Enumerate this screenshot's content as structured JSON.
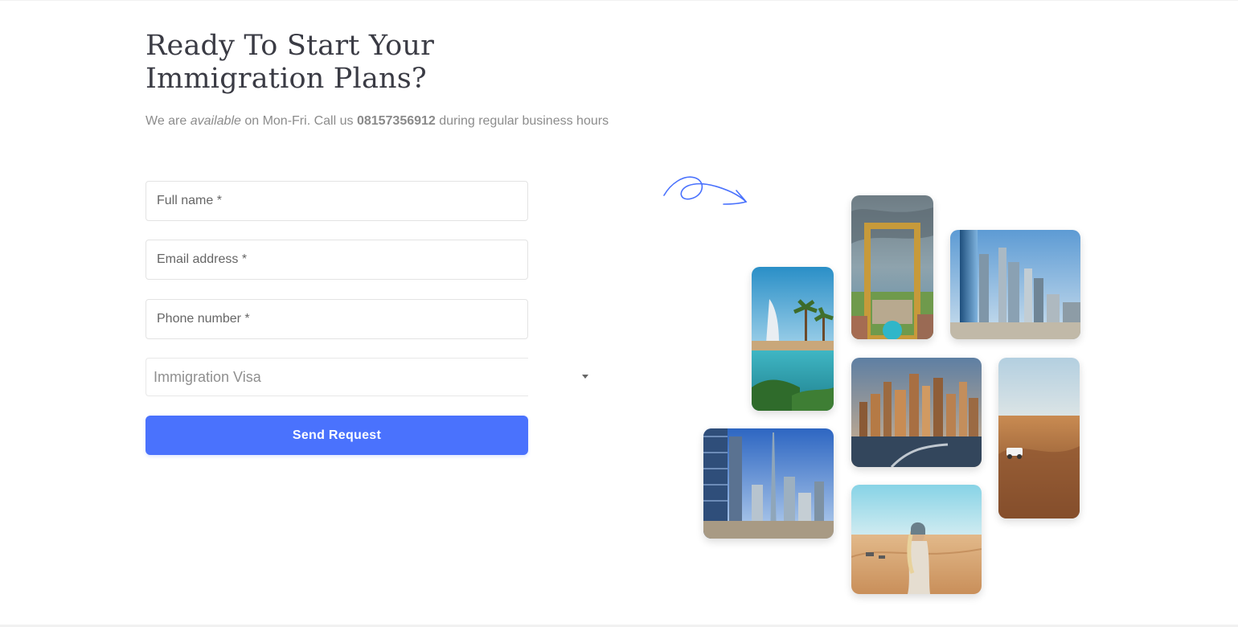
{
  "header": {
    "title": "Ready To Start Your Immigration Plans?",
    "subtitle_prefix": "We are ",
    "subtitle_emphasis": "available",
    "subtitle_mid": " on Mon-Fri. Call us ",
    "subtitle_phone": "08157356912",
    "subtitle_suffix": " during regular business hours"
  },
  "form": {
    "full_name_placeholder": "Full name *",
    "email_placeholder": "Email address *",
    "phone_placeholder": "Phone number *",
    "visa_select_value": "Immigration Visa",
    "submit_label": "Send Request"
  },
  "gallery": {
    "photos": [
      "burj-al-arab-canal",
      "dubai-frame",
      "skyline-towers",
      "marina-skyline-water",
      "desert-dunes-car",
      "burj-khalifa-downtown",
      "woman-in-desert"
    ]
  },
  "colors": {
    "accent": "#4a72fd",
    "heading": "#3a3b44",
    "body_text": "#8c8c8c",
    "doodle": "#4a72fd"
  }
}
